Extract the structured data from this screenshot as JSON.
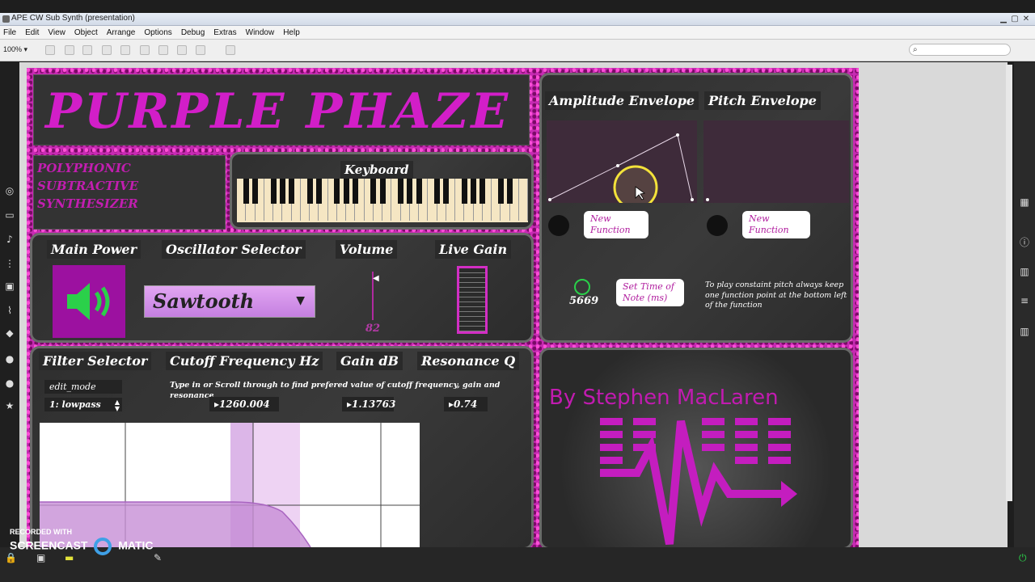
{
  "window": {
    "title": "APE CW Sub Synth (presentation)"
  },
  "menu": [
    "File",
    "Edit",
    "View",
    "Object",
    "Arrange",
    "Options",
    "Debug",
    "Extras",
    "Window",
    "Help"
  ],
  "toolbar": {
    "zoom": "100%"
  },
  "synth": {
    "title": "PURPLE PHAZE",
    "subtitle": "POLYPHONIC SUBTRACTIVE SYNTHESIZER",
    "keyboard_label": "Keyboard",
    "main_power_label": "Main Power",
    "oscillator_label": "Oscillator Selector",
    "oscillator_value": "Sawtooth",
    "volume_label": "Volume",
    "volume_value": "82",
    "live_gain_label": "Live Gain",
    "filter_selector_label": "Filter Selector",
    "cutoff_label": "Cutoff Frequency Hz",
    "gain_label": "Gain dB",
    "resonance_label": "Resonance Q",
    "edit_mode_label": "edit_mode",
    "filter_type": "1: lowpass",
    "filter_hint": "Type in or Scroll through to find prefered value of cutoff frequency, gain and resonance",
    "cutoff_value": "1260.004",
    "gain_value": "1.13763",
    "resonance_value": "0.74",
    "amplitude_env_label": "Amplitude Envelope",
    "pitch_env_label": "Pitch Envelope",
    "new_function_label": "New Function",
    "note_time_value": "5669",
    "set_time_label": "Set Time of Note (ms)",
    "pitch_hint": "To play constaint pitch always keep one function point at the bottom left of the function",
    "byline": "By Stephen MacLaren"
  },
  "watermark": {
    "line1": "RECORDED WITH",
    "line2": "SCREENCAST",
    "line3": "MATIC"
  }
}
